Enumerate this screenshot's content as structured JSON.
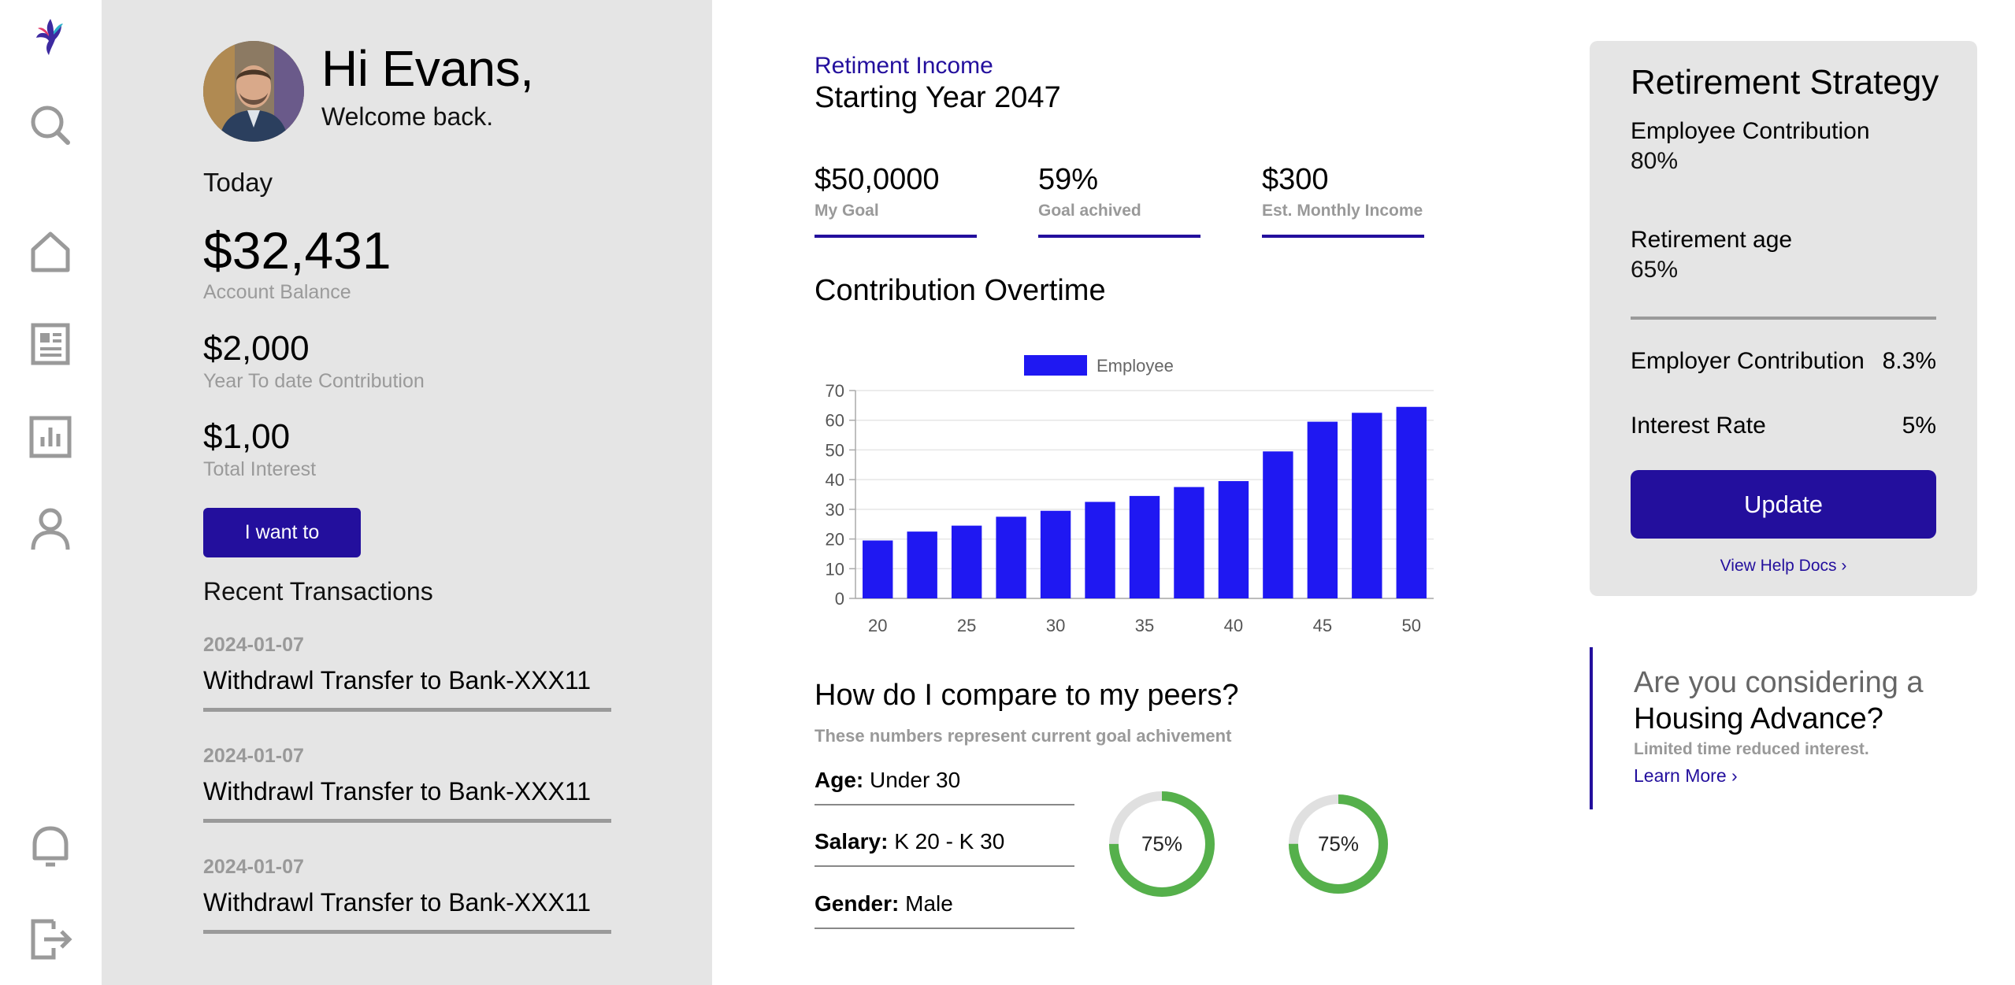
{
  "colors": {
    "accent": "#230f9d",
    "bar": "#1f18f2",
    "panel": "#e5e5e5",
    "donut": "#55b04b",
    "donut_track": "#e0e0e0"
  },
  "rail": {
    "icons": [
      "bird-logo-icon",
      "search-icon",
      "home-icon",
      "document-icon",
      "bar-chart-icon",
      "user-icon",
      "bell-icon",
      "logout-icon"
    ]
  },
  "profile": {
    "greeting": "Hi Evans,",
    "welcome": "Welcome back.",
    "today": "Today",
    "balance": "$32,431",
    "balance_label": "Account Balance",
    "ytd": "$2,000",
    "ytd_label": "Year To date Contribution",
    "interest": "$1,00",
    "interest_label": "Total Interest",
    "want_button": "I want to",
    "recent_title": "Recent Transactions",
    "transactions": [
      {
        "date": "2024-01-07",
        "desc": "Withdrawl Transfer to Bank-XXX11"
      },
      {
        "date": "2024-01-07",
        "desc": "Withdrawl Transfer to Bank-XXX11"
      },
      {
        "date": "2024-01-07",
        "desc": "Withdrawl Transfer to Bank-XXX11"
      }
    ]
  },
  "retirement": {
    "label": "Retiment Income",
    "year": "Starting Year 2047",
    "stats": [
      {
        "value": "$50,0000",
        "label": "My Goal"
      },
      {
        "value": "59%",
        "label": "Goal achived"
      },
      {
        "value": "$300",
        "label": "Est. Monthly Income"
      }
    ]
  },
  "contrib_title": "Contribution Overtime",
  "chart_data": {
    "type": "bar",
    "title": "",
    "legend": [
      "Employee"
    ],
    "legend_position": "top",
    "grid": true,
    "x_ticks": [
      "20",
      "25",
      "30",
      "35",
      "40",
      "45",
      "50"
    ],
    "y_ticks": [
      "0",
      "10",
      "20",
      "30",
      "40",
      "50",
      "60",
      "70"
    ],
    "ylim": [
      0,
      70
    ],
    "series": [
      {
        "name": "Employee",
        "values": [
          19.5,
          22.5,
          24.5,
          27.5,
          29.5,
          32.5,
          34.5,
          37.5,
          39.5,
          49.5,
          59.5,
          62.5,
          64.5
        ]
      }
    ]
  },
  "peers": {
    "title": "How do I compare to my peers?",
    "subtitle": "These numbers represent current goal achivement",
    "rows": [
      {
        "key": "Age:",
        "value": "Under 30"
      },
      {
        "key": "Salary:",
        "value": "K 20 - K 30"
      },
      {
        "key": "Gender:",
        "value": "Male"
      }
    ],
    "donuts": [
      {
        "label": "75%",
        "fraction": 0.75
      },
      {
        "label": "75%",
        "fraction": 0.75
      }
    ]
  },
  "strategy": {
    "title": "Retirement Strategy",
    "employee_label": "Employee Contribution",
    "employee_value": "80%",
    "age_label": "Retirement age",
    "age_value": "65%",
    "employer_label": "Employer Contribution",
    "employer_value": "8.3%",
    "interest_label": "Interest Rate",
    "interest_value": "5%",
    "update_button": "Update",
    "help_link": "View Help Docs ›"
  },
  "promo": {
    "line1": "Are you considering a",
    "line2": "Housing Advance?",
    "line3": "Limited time reduced interest.",
    "link": "Learn More  ›"
  }
}
